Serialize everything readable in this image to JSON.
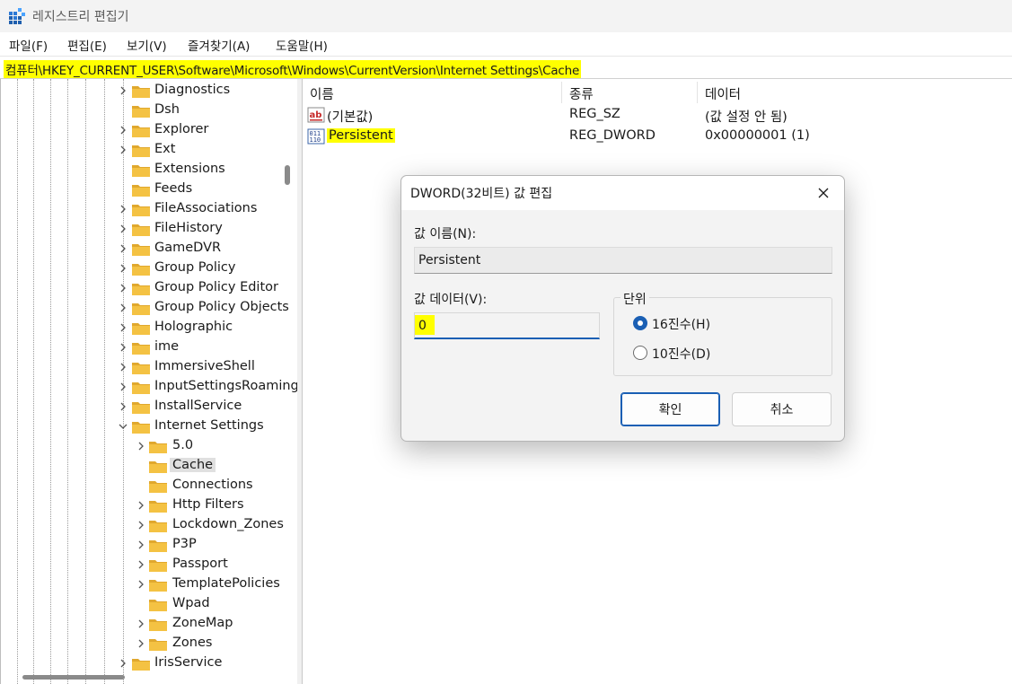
{
  "window": {
    "title": "레지스트리 편집기"
  },
  "menu": [
    "파일(F)",
    "편집(E)",
    "보기(V)",
    "즐겨찾기(A)",
    "도움말(H)"
  ],
  "address": "컴퓨터\\HKEY_CURRENT_USER\\Software\\Microsoft\\Windows\\CurrentVersion\\Internet Settings\\Cache",
  "tree": [
    {
      "label": "Diagnostics",
      "level": 0,
      "expander": "collapsed"
    },
    {
      "label": "Dsh",
      "level": 0,
      "expander": "none"
    },
    {
      "label": "Explorer",
      "level": 0,
      "expander": "collapsed"
    },
    {
      "label": "Ext",
      "level": 0,
      "expander": "collapsed"
    },
    {
      "label": "Extensions",
      "level": 0,
      "expander": "none"
    },
    {
      "label": "Feeds",
      "level": 0,
      "expander": "none"
    },
    {
      "label": "FileAssociations",
      "level": 0,
      "expander": "collapsed"
    },
    {
      "label": "FileHistory",
      "level": 0,
      "expander": "collapsed"
    },
    {
      "label": "GameDVR",
      "level": 0,
      "expander": "collapsed"
    },
    {
      "label": "Group Policy",
      "level": 0,
      "expander": "collapsed"
    },
    {
      "label": "Group Policy Editor",
      "level": 0,
      "expander": "collapsed"
    },
    {
      "label": "Group Policy Objects",
      "level": 0,
      "expander": "collapsed"
    },
    {
      "label": "Holographic",
      "level": 0,
      "expander": "collapsed"
    },
    {
      "label": "ime",
      "level": 0,
      "expander": "collapsed"
    },
    {
      "label": "ImmersiveShell",
      "level": 0,
      "expander": "collapsed"
    },
    {
      "label": "InputSettingsRoaming",
      "level": 0,
      "expander": "collapsed"
    },
    {
      "label": "InstallService",
      "level": 0,
      "expander": "collapsed"
    },
    {
      "label": "Internet Settings",
      "level": 0,
      "expander": "expanded"
    },
    {
      "label": "5.0",
      "level": 1,
      "expander": "collapsed"
    },
    {
      "label": "Cache",
      "level": 1,
      "expander": "none",
      "selected": true
    },
    {
      "label": "Connections",
      "level": 1,
      "expander": "none"
    },
    {
      "label": "Http Filters",
      "level": 1,
      "expander": "collapsed"
    },
    {
      "label": "Lockdown_Zones",
      "level": 1,
      "expander": "collapsed"
    },
    {
      "label": "P3P",
      "level": 1,
      "expander": "collapsed"
    },
    {
      "label": "Passport",
      "level": 1,
      "expander": "collapsed"
    },
    {
      "label": "TemplatePolicies",
      "level": 1,
      "expander": "collapsed"
    },
    {
      "label": "Wpad",
      "level": 1,
      "expander": "none"
    },
    {
      "label": "ZoneMap",
      "level": 1,
      "expander": "collapsed"
    },
    {
      "label": "Zones",
      "level": 1,
      "expander": "collapsed"
    },
    {
      "label": "IrisService",
      "level": 0,
      "expander": "collapsed"
    }
  ],
  "list": {
    "headers": [
      "이름",
      "종류",
      "데이터"
    ],
    "rows": [
      {
        "icon": "string-value-icon",
        "name": "(기본값)",
        "type": "REG_SZ",
        "data": "(값 설정 안 됨)",
        "highlight": false
      },
      {
        "icon": "dword-value-icon",
        "name": "Persistent",
        "type": "REG_DWORD",
        "data": "0x00000001 (1)",
        "highlight": true
      }
    ]
  },
  "dialog": {
    "title": "DWORD(32비트) 값 편집",
    "name_label": "값 이름(N):",
    "name_value": "Persistent",
    "data_label": "값 데이터(V):",
    "data_value": "0",
    "base_label": "단위",
    "hex_label": "16진수(H)",
    "dec_label": "10진수(D)",
    "selected_base": "hex",
    "ok_label": "확인",
    "cancel_label": "취소"
  },
  "colors": {
    "highlight": "#ffff00",
    "accent": "#1a5fb4",
    "folder": "#f4c243"
  }
}
